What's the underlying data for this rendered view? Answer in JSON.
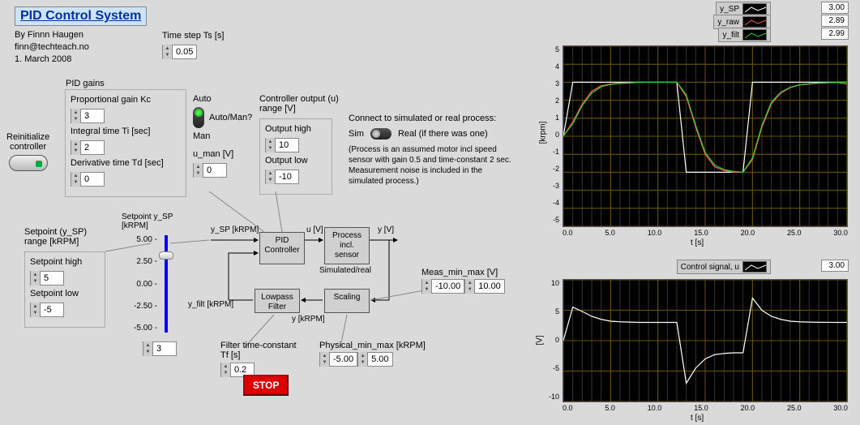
{
  "title": "PID Control System",
  "author": {
    "by": "By Finnn Haugen",
    "email": "finn@techteach.no",
    "date": "1. March 2008"
  },
  "timestep": {
    "label": "Time step Ts [s]",
    "value": "0.05"
  },
  "reinit": {
    "label": "Reinitialize\ncontroller"
  },
  "pid_gains": {
    "title": "PID gains",
    "kc": {
      "label": "Proportional gain Kc",
      "value": "3"
    },
    "ti": {
      "label": "Integral time Ti [sec]",
      "value": "2"
    },
    "td": {
      "label": "Derivative time Td [sec]",
      "value": "0"
    }
  },
  "auto_man": {
    "auto": "Auto",
    "man": "Man",
    "question": "Auto/Man?",
    "u_man_label": "u_man [V]",
    "u_man_value": "0"
  },
  "ctrl_out": {
    "title": "Controller output (u)\nrange [V]",
    "high_label": "Output high",
    "high": "10",
    "low_label": "Output low",
    "low": "-10"
  },
  "sim_real": {
    "connect": "Connect to simulated or real process:",
    "sim": "Sim",
    "real": "Real (if there was one)",
    "desc": "(Process is an assumed motor incl speed sensor with gain 0.5 and time-constant 2 sec. Measurement noise is included in the simulated process.)"
  },
  "setpoint_range": {
    "title": "Setpoint (y_SP)\nrange [kRPM]",
    "high_label": "Setpoint high",
    "high": "5",
    "low_label": "Setpoint low",
    "low": "-5"
  },
  "slider": {
    "title": "Setpoint y_SP\n[kRPM]",
    "ticks": [
      "5.00 -",
      "2.50 -",
      "0.00 -",
      "-2.50 -",
      "-5.00 -"
    ],
    "value": "3"
  },
  "blocks": {
    "pid": "PID\nController",
    "process": "Process\nincl.\nsensor",
    "sim_real": "Simulated/real",
    "lowpass": "Lowpass\nFilter",
    "scaling": "Scaling"
  },
  "signals": {
    "ysp": "y_SP [kRPM]",
    "u": "u [V]",
    "y": "y [V]",
    "yfilt": "y_filt [kRPM]",
    "ykrpm": "y [kRPM]"
  },
  "meas": {
    "label": "Meas_min_max [V]",
    "min": "-10.00",
    "max": "10.00"
  },
  "phys": {
    "label": "Physical_min_max [kRPM]",
    "min": "-5.00",
    "max": "5.00"
  },
  "filter": {
    "label": "Filter time-constant\nTf [s]",
    "value": "0.2"
  },
  "stop": "STOP",
  "chart1": {
    "legend": [
      {
        "name": "y_SP",
        "color": "#ffffff",
        "value": "3.00"
      },
      {
        "name": "y_raw",
        "color": "#ff5555",
        "value": "2.89"
      },
      {
        "name": "y_filt",
        "color": "#33cc33",
        "value": "2.99"
      }
    ],
    "ylabel": "[krpm]",
    "xlabel": "t [s]",
    "yticks": [
      "5",
      "4",
      "3",
      "2",
      "1",
      "0",
      "-1",
      "-2",
      "-3",
      "-4",
      "-5"
    ],
    "xticks": [
      "0.0",
      "5.0",
      "10.0",
      "15.0",
      "20.0",
      "25.0",
      "30.0"
    ]
  },
  "chart2": {
    "legend": {
      "name": "Control signal, u",
      "value": "3.00"
    },
    "ylabel": "[V]",
    "xlabel": "t [s]",
    "yticks": [
      "10",
      "5",
      "0",
      "-5",
      "-10"
    ],
    "xticks": [
      "0.0",
      "5.0",
      "10.0",
      "15.0",
      "20.0",
      "25.0",
      "30.0"
    ]
  },
  "chart_data": [
    {
      "type": "line",
      "title": "Setpoint / measurement",
      "xlabel": "t [s]",
      "ylabel": "[krpm]",
      "xlim": [
        0,
        30
      ],
      "ylim": [
        -5,
        5
      ],
      "x": [
        0,
        1,
        2,
        3,
        4,
        5,
        6,
        7,
        8,
        9,
        10,
        11,
        12,
        13,
        14,
        15,
        16,
        17,
        18,
        19,
        20,
        21,
        22,
        23,
        24,
        25,
        26,
        27,
        28,
        29,
        30
      ],
      "series": [
        {
          "name": "y_SP",
          "color": "#ffffff",
          "values": [
            0,
            3,
            3,
            3,
            3,
            3,
            3,
            3,
            3,
            3,
            3,
            3,
            3,
            -2,
            -2,
            -2,
            -2,
            -2,
            -2,
            -2,
            3,
            3,
            3,
            3,
            3,
            3,
            3,
            3,
            3,
            3,
            3
          ]
        },
        {
          "name": "y_raw",
          "color": "#ff5555",
          "values": [
            0,
            0.8,
            1.8,
            2.5,
            2.8,
            2.9,
            2.95,
            2.97,
            3.0,
            3.0,
            3.0,
            3.0,
            3.0,
            2.2,
            0.5,
            -1.0,
            -1.7,
            -1.9,
            -2.0,
            -2.0,
            -1.3,
            0.5,
            1.8,
            2.4,
            2.7,
            2.85,
            2.9,
            2.95,
            2.97,
            2.98,
            2.89
          ]
        },
        {
          "name": "y_filt",
          "color": "#33cc33",
          "values": [
            0,
            0.7,
            1.7,
            2.4,
            2.75,
            2.88,
            2.93,
            2.96,
            2.99,
            3.0,
            3.0,
            3.0,
            3.0,
            2.3,
            0.6,
            -0.9,
            -1.6,
            -1.85,
            -1.95,
            -2.0,
            -1.2,
            0.6,
            1.9,
            2.45,
            2.72,
            2.86,
            2.92,
            2.96,
            2.98,
            2.99,
            2.99
          ]
        }
      ]
    },
    {
      "type": "line",
      "title": "Control signal, u",
      "xlabel": "t [s]",
      "ylabel": "[V]",
      "xlim": [
        0,
        30
      ],
      "ylim": [
        -10,
        10
      ],
      "x": [
        0,
        1,
        2,
        3,
        4,
        5,
        6,
        7,
        8,
        9,
        10,
        11,
        12,
        13,
        14,
        15,
        16,
        17,
        18,
        19,
        20,
        21,
        22,
        23,
        24,
        25,
        26,
        27,
        28,
        29,
        30
      ],
      "series": [
        {
          "name": "u",
          "color": "#ffffff",
          "values": [
            0,
            5.5,
            4.8,
            4.0,
            3.5,
            3.2,
            3.1,
            3.05,
            3.0,
            3.0,
            3.0,
            3.0,
            3.0,
            -7.0,
            -4.5,
            -3.0,
            -2.3,
            -2.1,
            -2.0,
            -2.0,
            7.0,
            5.0,
            4.0,
            3.5,
            3.2,
            3.1,
            3.05,
            3.02,
            3.01,
            3.0,
            3.0
          ]
        }
      ]
    }
  ]
}
